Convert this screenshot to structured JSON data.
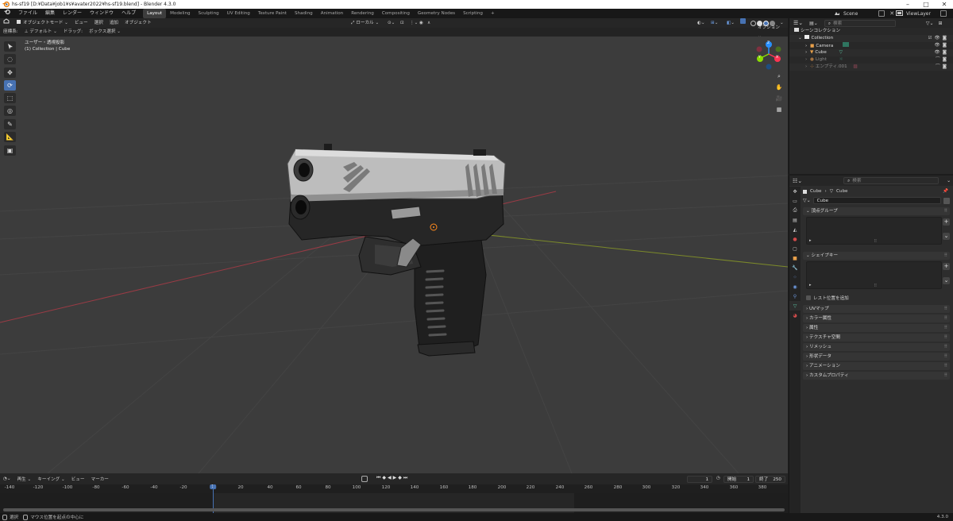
{
  "window": {
    "title": "hs-sf19 [D:¥Data¥job1¥s¥avater2022¥hs-sf19.blend] - Blender 4.3.0",
    "minimize": "–",
    "maximize": "□",
    "close": "✕"
  },
  "menu": [
    "ファイル",
    "編集",
    "レンダー",
    "ウィンドウ",
    "ヘルプ"
  ],
  "workspaces": [
    "Layout",
    "Modeling",
    "Sculpting",
    "UV Editing",
    "Texture Paint",
    "Shading",
    "Animation",
    "Rendering",
    "Compositing",
    "Geometry Nodes",
    "Scripting"
  ],
  "add_workspace": "+",
  "scene": {
    "name": "Scene",
    "view_layer": "ViewLayer"
  },
  "viewport_header": {
    "mode": "オブジェクトモード",
    "menus": [
      "ビュー",
      "選択",
      "追加",
      "オブジェクト"
    ],
    "transform_orientation": "ローカル",
    "options": "オプション"
  },
  "tool_header": {
    "label": "座標系:",
    "orientation": "デフォルト",
    "drag_label": "ドラッグ:",
    "drag_value": "ボックス選択"
  },
  "viewport_info": {
    "view": "ユーザー・透視投影",
    "collection": "(1) Collection | Cube"
  },
  "gizmo": {
    "x": "X",
    "y": "Y",
    "z": "Z"
  },
  "timeline": {
    "playback": "再生",
    "keying": "キーイング",
    "view": "ビュー",
    "marker": "マーカー",
    "current_frame": "1",
    "start_label": "開始",
    "start": "1",
    "end_label": "終了",
    "end": "250",
    "frame_marker": "1",
    "ruler": [
      "-140",
      "-120",
      "-100",
      "-80",
      "-60",
      "-40",
      "-20",
      "20",
      "40",
      "60",
      "80",
      "100",
      "120",
      "140",
      "160",
      "180",
      "200",
      "220",
      "240",
      "260",
      "280",
      "300",
      "320",
      "340",
      "360",
      "380"
    ]
  },
  "status": {
    "hint": "選択",
    "hint2": "マウス位置を起点の中心に",
    "version": "4.3.0"
  },
  "outliner": {
    "search_placeholder": "検索",
    "scene_collection": "シーンコレクション",
    "items": [
      {
        "name": "Collection",
        "kind": "collection"
      },
      {
        "name": "Camera",
        "kind": "camera"
      },
      {
        "name": "Cube",
        "kind": "mesh"
      },
      {
        "name": "Light",
        "kind": "light"
      },
      {
        "name": "エンプティ.001",
        "kind": "empty"
      }
    ]
  },
  "properties": {
    "search_placeholder": "検索",
    "breadcrumb_object": "Cube",
    "breadcrumb_data": "Cube",
    "data_name": "Cube",
    "vertex_groups": "頂点グループ",
    "shape_keys": "シェイプキー",
    "rest_position": "レスト位置を追加",
    "panels": [
      "UVマップ",
      "カラー属性",
      "属性",
      "テクスチャ空間",
      "リメッシュ",
      "形状データ",
      "アニメーション",
      "カスタムプロパティ"
    ]
  },
  "colors": {
    "accent": "#4772b3",
    "x_axis": "#ff3352",
    "y_axis": "#8bdc00",
    "z_axis": "#2890ff",
    "viewport_bg": "#3c3c3c"
  }
}
